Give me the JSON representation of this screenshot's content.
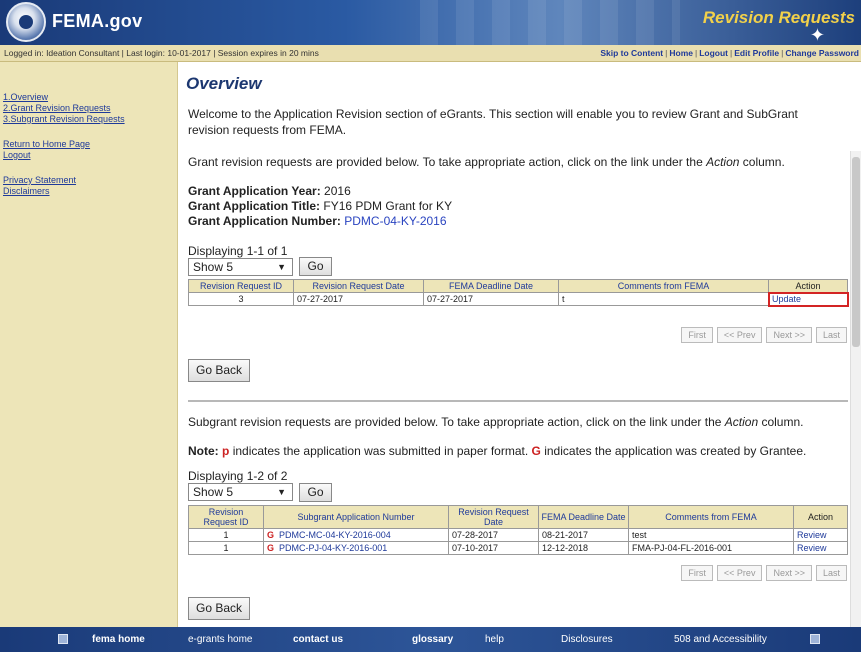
{
  "header": {
    "brand": "FEMA.gov",
    "section_title": "Revision Requests"
  },
  "statusbar": {
    "left": "Logged in: Ideation Consultant   |  Last login: 10-01-2017   |  Session expires in 20 mins",
    "links": [
      "Skip to Content",
      "Home",
      "Logout",
      "Edit Profile",
      "Change Password"
    ]
  },
  "sidebar": {
    "items": [
      "1.Overview",
      "2.Grant Revision Requests",
      "3.Subgrant Revision Requests",
      "Return to Home Page",
      "Logout",
      "Privacy Statement",
      "Disclaimers"
    ]
  },
  "main": {
    "title": "Overview",
    "welcome": "Welcome to the Application Revision section of eGrants. This section will enable you to review Grant and SubGrant revision requests from FEMA.",
    "grant_intro_pre": "Grant revision requests are provided below. To take appropriate action, click on the link under the ",
    "action_word": "Action",
    "grant_intro_post": " column.",
    "year_label": "Grant Application Year:",
    "year_value": "2016",
    "app_title_label": "Grant Application Title:",
    "app_title_value": "FY16 PDM Grant for KY",
    "app_number_label": "Grant Application Number:",
    "app_number_value": "PDMC-04-KY-2016",
    "grant_display": "Displaying 1-1 of 1",
    "show_value": "Show 5",
    "go_label": "Go",
    "grant_headers": [
      "Revision Request ID",
      "Revision Request Date",
      "FEMA Deadline Date",
      "Comments from FEMA",
      "Action"
    ],
    "grant_rows": [
      {
        "id": "3",
        "request_date": "07-27-2017",
        "deadline": "07-27-2017",
        "comments": "t",
        "action": "Update"
      }
    ],
    "pager": [
      "First",
      "<< Prev",
      "Next >>",
      "Last"
    ],
    "go_back": "Go Back",
    "subgrant_intro_pre": "Subgrant revision requests are provided below. To take appropriate action, click on the link under the ",
    "subgrant_intro_post": " column.",
    "note_label": "Note:",
    "note_p_mark": "p",
    "note_mid": " indicates the application was submitted in paper format. ",
    "note_g_mark": "G",
    "note_end": " indicates the application was created by Grantee.",
    "sub_display": "Displaying 1-2 of 2",
    "sub_headers": [
      "Revision Request ID",
      "Subgrant Application Number",
      "Revision Request Date",
      "FEMA Deadline Date",
      "Comments from FEMA",
      "Action"
    ],
    "sub_rows": [
      {
        "id": "1",
        "mark": "G",
        "number": "PDMC-MC-04-KY-2016-004",
        "request_date": "07-28-2017",
        "deadline": "08-21-2017",
        "comments": "test",
        "action": "Review"
      },
      {
        "id": "1",
        "mark": "G",
        "number": "PDMC-PJ-04-KY-2016-001",
        "request_date": "07-10-2017",
        "deadline": "12-12-2018",
        "comments": "FMA-PJ-04-FL-2016-001",
        "action": "Review"
      }
    ]
  },
  "footer": {
    "items": [
      "fema home",
      "e-grants home",
      "contact us",
      "glossary",
      "help",
      "Disclosures",
      "508 and Accessibility"
    ]
  }
}
